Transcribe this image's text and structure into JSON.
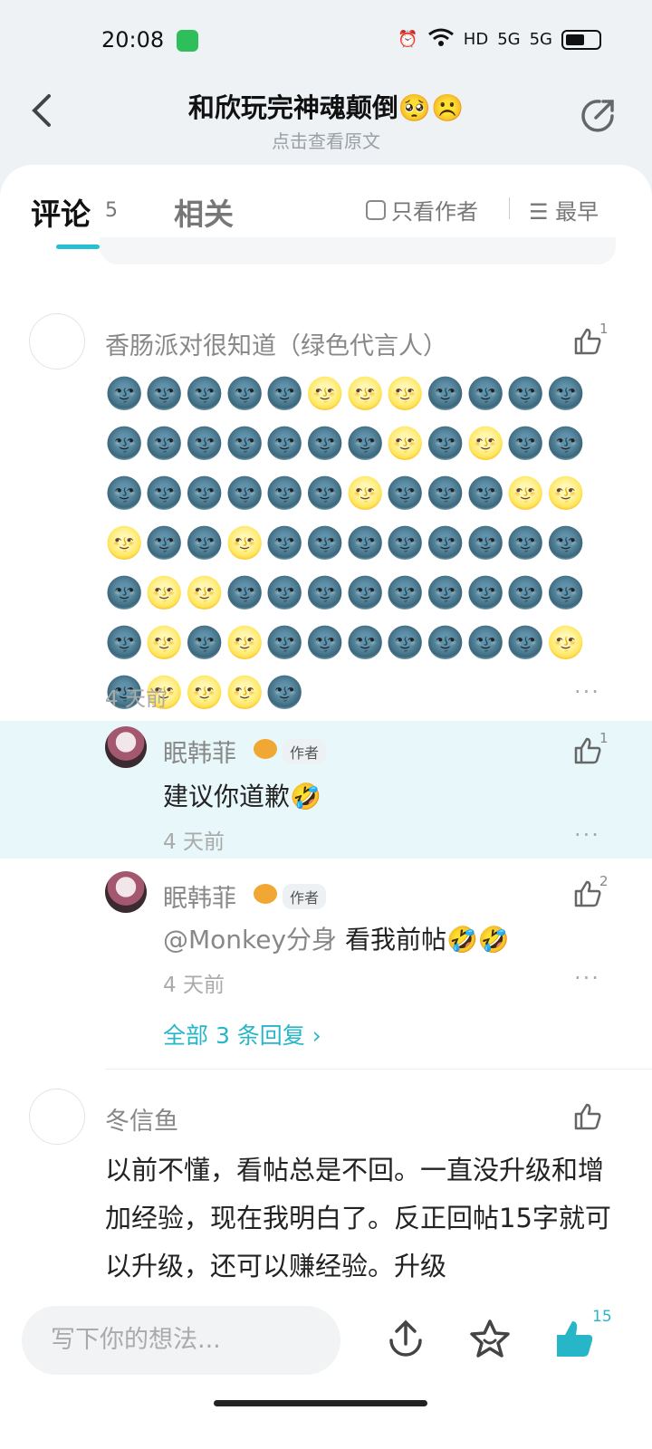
{
  "status_bar": {
    "time": "20:08",
    "network_label": "5G",
    "hd_label": "HD"
  },
  "header": {
    "title": "和欣玩完神魂颠倒🥺☹️",
    "subtitle": "点击查看原文"
  },
  "tabs": {
    "comments_label": "评论",
    "comments_count": "5",
    "related_label": "相关",
    "only_author_label": "只看作者",
    "sort_label": "最早"
  },
  "comment1": {
    "username": "香肠派对很知道（绿色代言人）",
    "likes": "1",
    "emojis": "🌚🌚🌚🌚🌚🌝🌝🌝🌚🌚🌚🌚🌚🌚🌚🌚🌚🌚🌚🌝🌚🌝🌚🌚🌚🌚🌚🌚🌚🌚🌝🌚🌚🌚🌝🌝🌝🌚🌚🌝🌚🌚🌚🌚🌚🌚🌚🌚🌚🌝🌝🌚🌚🌚🌚🌚🌚🌚🌚🌚🌚🌝🌚🌝🌚🌚🌚🌚🌚🌚🌚🌝🌚🌝🌝🌝🌚",
    "time": "4 天前"
  },
  "reply1": {
    "username": "眠韩菲",
    "author_tag": "作者",
    "likes": "1",
    "text": "建议你道歉🤣",
    "time": "4 天前"
  },
  "reply2": {
    "username": "眠韩菲",
    "author_tag": "作者",
    "likes": "2",
    "mention": "@Monkey分身",
    "text": "看我前帖🤣🤣",
    "time": "4 天前"
  },
  "all_replies_label": "全部 3 条回复 ›",
  "comment2": {
    "username": "冬信鱼",
    "text": "以前不懂，看帖总是不回。一直没升级和增加经验，现在我明白了。反正回帖15字就可以升级，还可以赚经验。升级"
  },
  "bottom_bar": {
    "input_placeholder": "写下你的想法...",
    "like_count": "15"
  },
  "colors": {
    "accent": "#26c0d3",
    "highlight_bg": "#e8f7fa"
  }
}
